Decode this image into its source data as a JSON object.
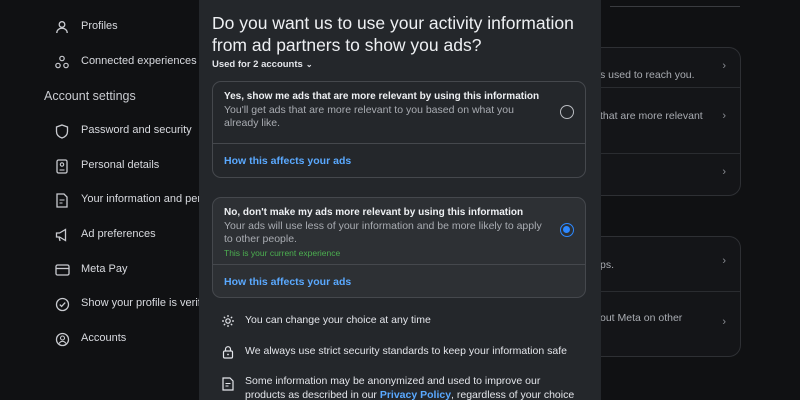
{
  "sidebar": {
    "items_top": [
      {
        "label": "Profiles",
        "icon": "person-icon"
      },
      {
        "label": "Connected experiences",
        "icon": "connected-icon"
      }
    ],
    "section_heading": "Account settings",
    "items": [
      {
        "label": "Password and security",
        "icon": "shield-icon"
      },
      {
        "label": "Personal details",
        "icon": "id-card-icon"
      },
      {
        "label": "Your information and per",
        "icon": "info-doc-icon"
      },
      {
        "label": "Ad preferences",
        "icon": "megaphone-icon"
      },
      {
        "label": "Meta Pay",
        "icon": "card-icon"
      },
      {
        "label": "Show your profile is verif",
        "icon": "verified-icon"
      },
      {
        "label": "Accounts",
        "icon": "account-circle-icon"
      }
    ]
  },
  "right_panel": {
    "card1": [
      "s used to reach you.",
      "that are more relevant",
      ""
    ],
    "card2": [
      "ps.",
      "out Meta on other"
    ]
  },
  "dialog": {
    "title": "Do you want us to use your activity information from ad partners to show you ads?",
    "used_for": "Used for 2 accounts",
    "options": [
      {
        "title": "Yes, show me ads that are more relevant by using this information",
        "description": "You'll get ads that are more relevant to you based on what you already like.",
        "current": "",
        "link": "How this affects your ads",
        "selected": false
      },
      {
        "title": "No, don't make my ads more relevant by using this information",
        "description": "Your ads will use less of your information and be more likely to apply to other people.",
        "current": "This is your current experience",
        "link": "How this affects your ads",
        "selected": true
      }
    ],
    "info": [
      {
        "text": "You can change your choice at any time",
        "icon": "gear-icon"
      },
      {
        "text": "We always use strict security standards to keep your information safe",
        "icon": "lock-icon"
      },
      {
        "text_line1": "Some information may be anonymized and used to improve our",
        "text_line2_pre": "products as described in our ",
        "link": "Privacy Policy",
        "text_line2_post": ", regardless of your choice",
        "icon": "document-icon"
      }
    ]
  },
  "colors": {
    "accent": "#2d88ff",
    "link": "#5aa9ff",
    "current": "#4caf50"
  }
}
